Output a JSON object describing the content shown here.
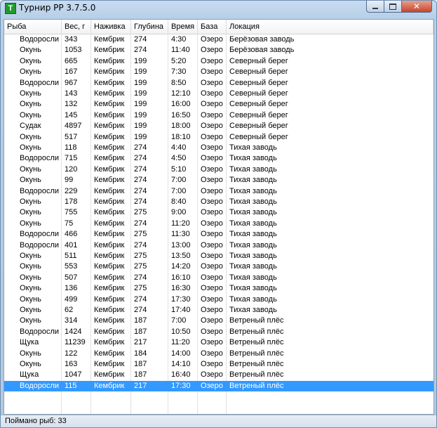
{
  "window": {
    "title": "Турнир РР 3.7.5.0",
    "icon_letter": "T",
    "icon_color": "#1d9a2c"
  },
  "table": {
    "columns": [
      "Рыба",
      "Вес, г",
      "Наживка",
      "Глубина",
      "Время",
      "База",
      "Локация"
    ],
    "rows": [
      [
        "Водоросли",
        "343",
        "Кембрик",
        "274",
        "4:30",
        "Озеро",
        "Берёзовая заводь"
      ],
      [
        "Окунь",
        "1053",
        "Кембрик",
        "274",
        "11:40",
        "Озеро",
        "Берёзовая заводь"
      ],
      [
        "Окунь",
        "665",
        "Кембрик",
        "199",
        "5:20",
        "Озеро",
        "Северный берег"
      ],
      [
        "Окунь",
        "167",
        "Кембрик",
        "199",
        "7:30",
        "Озеро",
        "Северный берег"
      ],
      [
        "Водоросли",
        "967",
        "Кембрик",
        "199",
        "8:50",
        "Озеро",
        "Северный берег"
      ],
      [
        "Окунь",
        "143",
        "Кембрик",
        "199",
        "12:10",
        "Озеро",
        "Северный берег"
      ],
      [
        "Окунь",
        "132",
        "Кембрик",
        "199",
        "16:00",
        "Озеро",
        "Северный берег"
      ],
      [
        "Окунь",
        "145",
        "Кембрик",
        "199",
        "16:50",
        "Озеро",
        "Северный берег"
      ],
      [
        "Судак",
        "4897",
        "Кембрик",
        "199",
        "18:00",
        "Озеро",
        "Северный берег"
      ],
      [
        "Окунь",
        "517",
        "Кембрик",
        "199",
        "18:10",
        "Озеро",
        "Северный берег"
      ],
      [
        "Окунь",
        "118",
        "Кембрик",
        "274",
        "4:40",
        "Озеро",
        "Тихая заводь"
      ],
      [
        "Водоросли",
        "715",
        "Кембрик",
        "274",
        "4:50",
        "Озеро",
        "Тихая заводь"
      ],
      [
        "Окунь",
        "120",
        "Кембрик",
        "274",
        "5:10",
        "Озеро",
        "Тихая заводь"
      ],
      [
        "Окунь",
        "99",
        "Кембрик",
        "274",
        "7:00",
        "Озеро",
        "Тихая заводь"
      ],
      [
        "Водоросли",
        "229",
        "Кембрик",
        "274",
        "7:00",
        "Озеро",
        "Тихая заводь"
      ],
      [
        "Окунь",
        "178",
        "Кембрик",
        "274",
        "8:40",
        "Озеро",
        "Тихая заводь"
      ],
      [
        "Окунь",
        "755",
        "Кембрик",
        "275",
        "9:00",
        "Озеро",
        "Тихая заводь"
      ],
      [
        "Окунь",
        "75",
        "Кембрик",
        "274",
        "11:20",
        "Озеро",
        "Тихая заводь"
      ],
      [
        "Водоросли",
        "466",
        "Кембрик",
        "275",
        "11:30",
        "Озеро",
        "Тихая заводь"
      ],
      [
        "Водоросли",
        "401",
        "Кембрик",
        "274",
        "13:00",
        "Озеро",
        "Тихая заводь"
      ],
      [
        "Окунь",
        "511",
        "Кембрик",
        "275",
        "13:50",
        "Озеро",
        "Тихая заводь"
      ],
      [
        "Окунь",
        "553",
        "Кембрик",
        "275",
        "14:20",
        "Озеро",
        "Тихая заводь"
      ],
      [
        "Окунь",
        "507",
        "Кембрик",
        "274",
        "16:10",
        "Озеро",
        "Тихая заводь"
      ],
      [
        "Окунь",
        "136",
        "Кембрик",
        "275",
        "16:30",
        "Озеро",
        "Тихая заводь"
      ],
      [
        "Окунь",
        "499",
        "Кембрик",
        "274",
        "17:30",
        "Озеро",
        "Тихая заводь"
      ],
      [
        "Окунь",
        "62",
        "Кембрик",
        "274",
        "17:40",
        "Озеро",
        "Тихая заводь"
      ],
      [
        "Окунь",
        "314",
        "Кембрик",
        "187",
        "7:00",
        "Озеро",
        "Ветреный плёс"
      ],
      [
        "Водоросли",
        "1424",
        "Кембрик",
        "187",
        "10:50",
        "Озеро",
        "Ветреный плёс"
      ],
      [
        "Щука",
        "11239",
        "Кембрик",
        "217",
        "11:20",
        "Озеро",
        "Ветреный плёс"
      ],
      [
        "Окунь",
        "122",
        "Кембрик",
        "184",
        "14:00",
        "Озеро",
        "Ветреный плёс"
      ],
      [
        "Окунь",
        "163",
        "Кембрик",
        "187",
        "14:10",
        "Озеро",
        "Ветреный плёс"
      ],
      [
        "Щука",
        "1047",
        "Кембрик",
        "187",
        "16:40",
        "Озеро",
        "Ветреный плёс"
      ],
      [
        "Водоросли",
        "115",
        "Кембрик",
        "217",
        "17:30",
        "Озеро",
        "Ветреный плёс"
      ]
    ],
    "selected_row": 32,
    "selection_color": "#3399ff"
  },
  "status": {
    "text": "Поймано рыб: 33"
  }
}
